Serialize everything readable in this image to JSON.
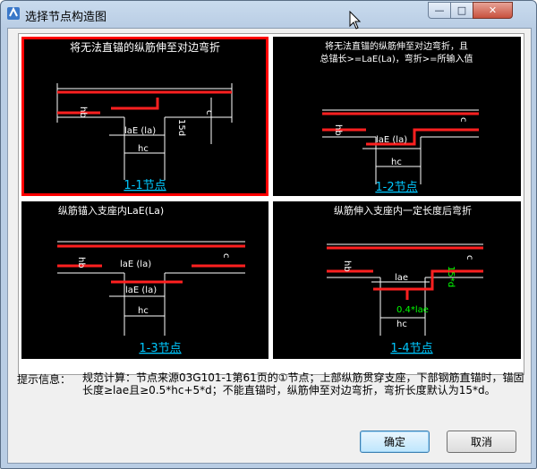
{
  "window": {
    "title": "选择节点构造图",
    "controls": {
      "minimize": "—",
      "maximize": "□",
      "close": "✕"
    }
  },
  "panels": [
    {
      "id": "1-1",
      "caption": "将无法直锚的纵筋伸至对边弯折",
      "node_label": "1-1节点",
      "selected": true,
      "dims": {
        "hb": "hb",
        "hc": "hc",
        "laE": "laE (la)",
        "bend": "15d",
        "c": "c"
      }
    },
    {
      "id": "1-2",
      "caption": "将无法直锚的纵筋伸至对边弯折，且",
      "caption2": "总锚长>=LaE(La)，弯折>=所输入值",
      "node_label": "1-2节点",
      "selected": false,
      "dims": {
        "hb": "hb",
        "hc": "hc",
        "laE": "laE (la)",
        "c": "c"
      }
    },
    {
      "id": "1-3",
      "caption": "纵筋锚入支座内LaE(La)",
      "node_label": "1-3节点",
      "selected": false,
      "dims": {
        "hb": "hb",
        "hc": "hc",
        "laE_top": "laE (la)",
        "laE_bottom": "laE (la)",
        "c": "c"
      }
    },
    {
      "id": "1-4",
      "caption": "纵筋伸入支座内一定长度后弯折",
      "node_label": "1-4节点",
      "selected": false,
      "dims": {
        "hb": "hb",
        "hc": "hc",
        "lae": "lae",
        "bend": "15*d",
        "ratio": "0.4*lae",
        "c": "c"
      }
    }
  ],
  "info": {
    "label": "提示信息：",
    "text": "规范计算：节点来源03G101-1第61页的①节点；上部纵筋贯穿支座，下部钢筋直锚时，锚固长度≥lae且≥0.5*hc+5*d；不能直锚时，纵筋伸至对边弯折，弯折长度默认为15*d。"
  },
  "buttons": {
    "ok": "确定",
    "cancel": "取消"
  },
  "colors": {
    "bar": "#ff2020",
    "line": "#ffffff",
    "caption_link": "#00c8ff",
    "bend_label": "#00ff00",
    "select_border": "#ff0000"
  }
}
